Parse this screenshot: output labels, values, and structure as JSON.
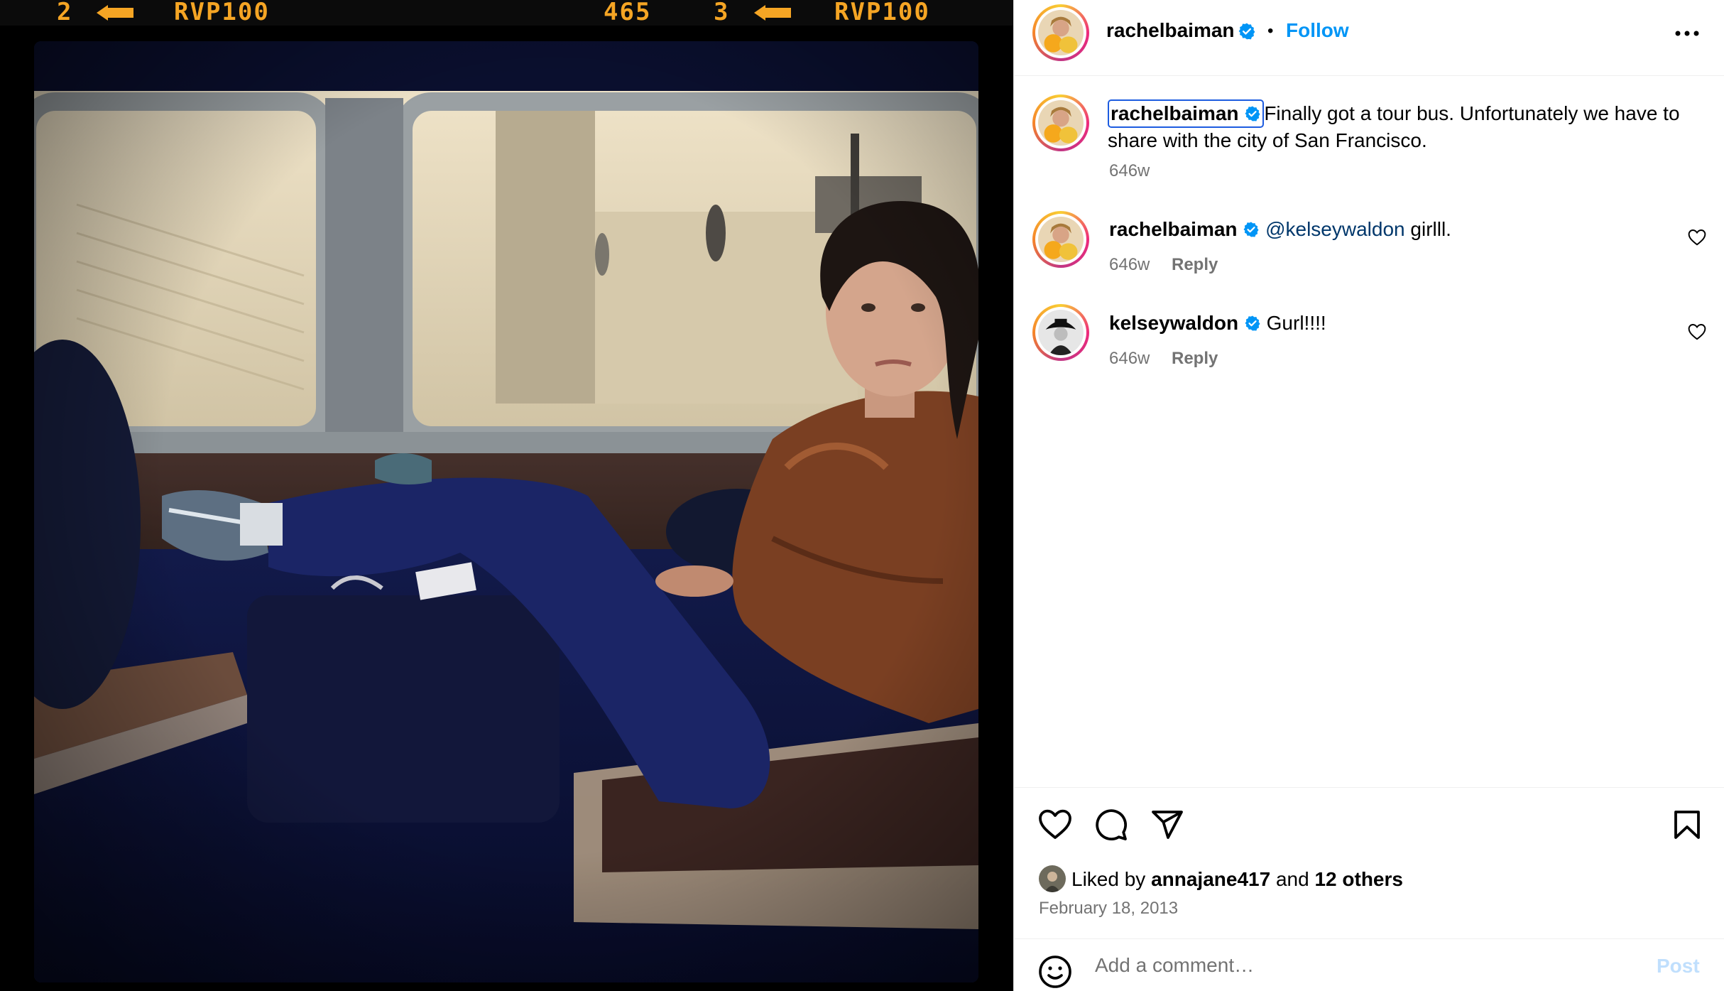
{
  "photo": {
    "film_strip": {
      "left_frame": "2",
      "left_code": "RVP100",
      "right_counter": "465",
      "right_frame": "3",
      "right_code": "RVP100",
      "color": "#f5a524"
    },
    "alt": "Woman in brown leather jacket sitting on a bus with feet up"
  },
  "header": {
    "username": "rachelbaiman",
    "verified": true,
    "separator": "•",
    "follow_label": "Follow",
    "more_icon": "more-horizontal-icon"
  },
  "caption": {
    "username": "rachelbaiman",
    "text": "Finally got a tour bus. Unfortunately we have to share with the city of San Francisco.",
    "time": "646w"
  },
  "comments": [
    {
      "username": "rachelbaiman",
      "mention": "@kelseywaldon",
      "text": " girlll.",
      "time": "646w",
      "reply_label": "Reply"
    },
    {
      "username": "kelseywaldon",
      "mention": "",
      "text": "Gurl!!!!",
      "time": "646w",
      "reply_label": "Reply"
    }
  ],
  "actions": {
    "like_icon": "heart-icon",
    "comment_icon": "comment-icon",
    "share_icon": "share-icon",
    "save_icon": "bookmark-icon"
  },
  "likes": {
    "prefix": "Liked by ",
    "user": "annajane417",
    "middle": " and ",
    "others": "12 others"
  },
  "post_date": "February 18, 2013",
  "comment_box": {
    "placeholder": "Add a comment…",
    "post_label": "Post"
  },
  "colors": {
    "accent": "#0095f6",
    "verified": "#0095f6",
    "muted": "#737373",
    "post_disabled": "#c0dffd"
  }
}
